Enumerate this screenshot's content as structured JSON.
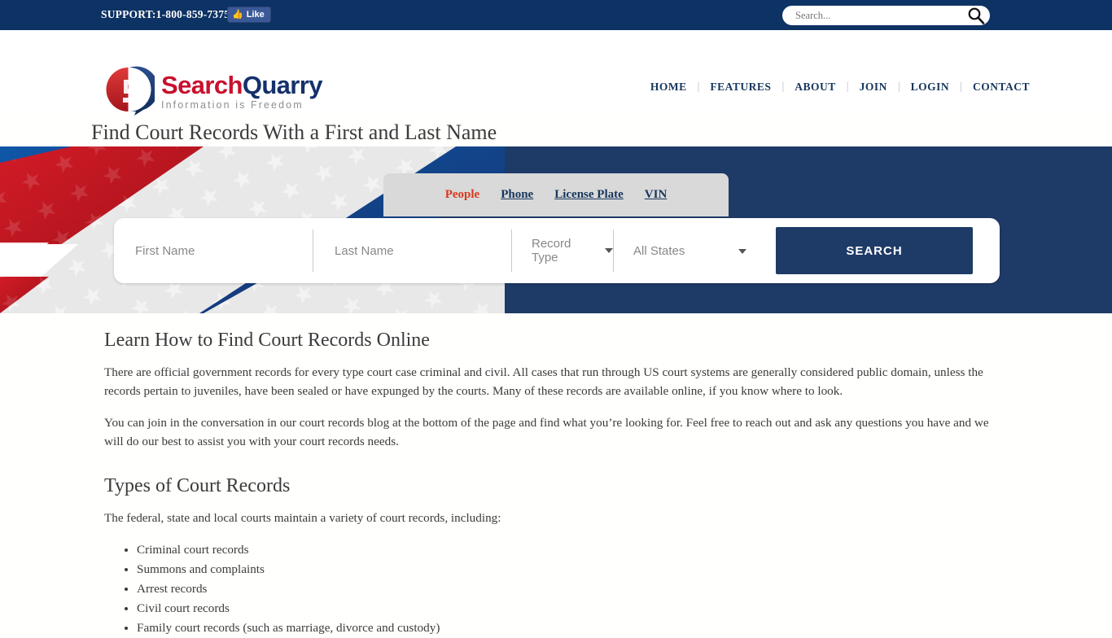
{
  "topbar": {
    "support": "SUPPORT:1-800-859-7375",
    "like_label": "Like",
    "search_placeholder": "Search...",
    "search_value": ""
  },
  "logo": {
    "word1": "Search",
    "word2": "Quarry",
    "tagline": "Information is Freedom",
    "color_red": "#c8102e",
    "color_blue": "#14316b"
  },
  "nav": {
    "items": [
      {
        "label": "HOME"
      },
      {
        "label": "FEATURES"
      },
      {
        "label": "ABOUT"
      },
      {
        "label": "JOIN"
      },
      {
        "label": "LOGIN"
      },
      {
        "label": "CONTACT"
      }
    ],
    "separator": "|"
  },
  "page": {
    "title": "Find Court Records With a First and Last Name"
  },
  "hero": {
    "background_color": "#1e3a66",
    "tabs": [
      {
        "label": "People",
        "active": true
      },
      {
        "label": "Phone",
        "active": false
      },
      {
        "label": "License Plate",
        "active": false
      },
      {
        "label": "VIN",
        "active": false
      }
    ],
    "active_tab_color": "#d9381e",
    "form": {
      "first_name_placeholder": "First Name",
      "first_name_value": "",
      "last_name_placeholder": "Last Name",
      "last_name_value": "",
      "record_type_label": "Record Type",
      "state_label": "All States",
      "search_button": "SEARCH"
    }
  },
  "main": {
    "heading1": "Learn How to Find Court Records Online",
    "paragraph1": "There are official government records for every type court case criminal and civil. All cases that run through US court systems are generally considered public domain, unless the records pertain to juveniles, have been sealed or have expunged by the courts. Many of these records are available online, if you know where to look.",
    "paragraph2": "You can join in the conversation in our court records blog at the bottom of the page and find what you’re looking for. Feel free to reach out and ask any questions you have and we will do our best to assist you with your court records needs.",
    "heading2": "Types of Court Records",
    "paragraph3": "The federal, state and local courts maintain a variety of court records, including:",
    "bullets": [
      "Criminal court records",
      "Summons and complaints",
      "Arrest records",
      "Civil court records",
      "Family court records (such as marriage, divorce and custody)"
    ]
  }
}
